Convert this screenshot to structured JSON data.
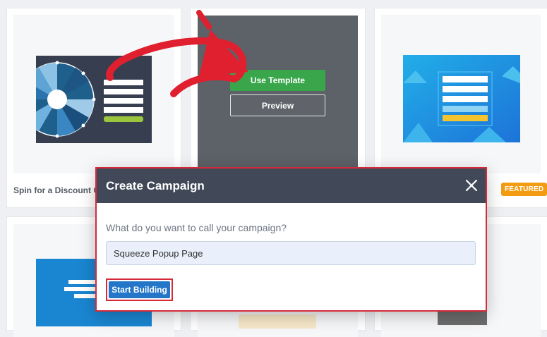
{
  "cards": [
    {
      "title": "Spin for a Discount C"
    },
    {
      "title": ""
    },
    {
      "title": ""
    }
  ],
  "hover_actions": {
    "use_template_label": "Use Template",
    "preview_label": "Preview"
  },
  "featured_badge": "FEATURED",
  "modal": {
    "title": "Create Campaign",
    "question": "What do you want to call your campaign?",
    "input_value": "Squeeze Popup Page",
    "start_button": "Start Building"
  },
  "colors": {
    "use_template_green": "#3aa64c",
    "start_button_blue": "#2476c8",
    "highlight_red": "#d62a3a",
    "arrow_red": "#e0202e",
    "modal_header": "#414959",
    "featured_orange": "#f39c12"
  }
}
